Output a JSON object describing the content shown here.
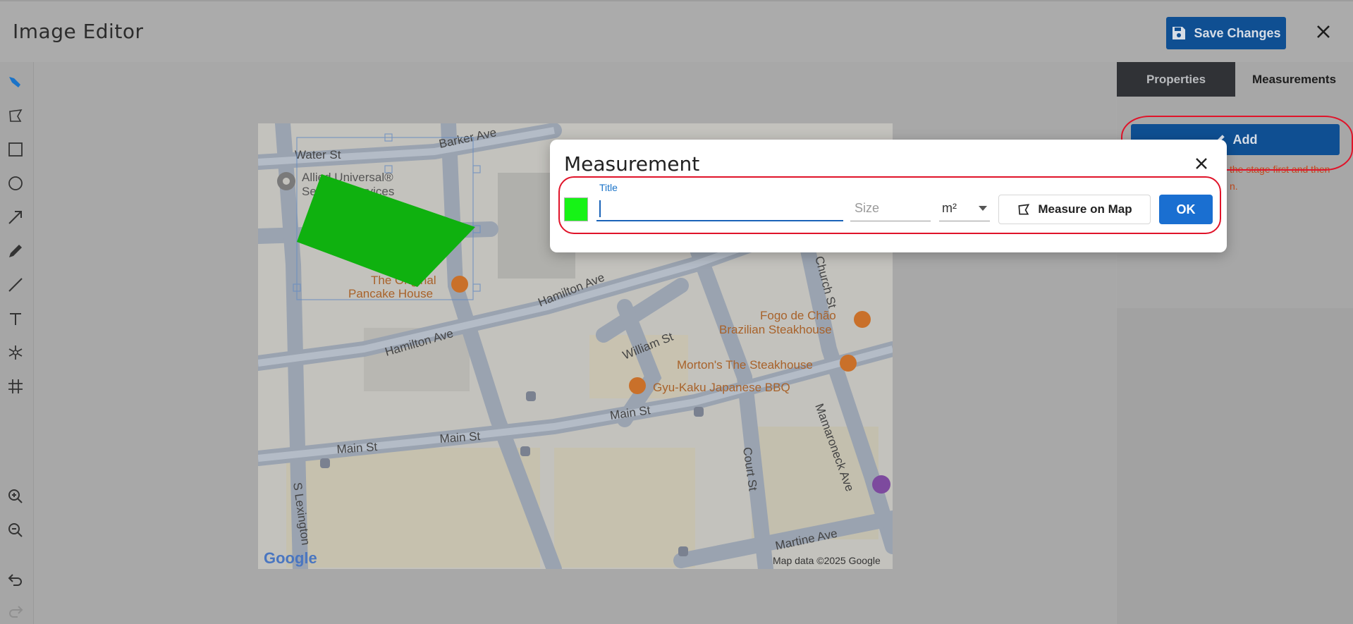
{
  "header": {
    "title": "Image Editor",
    "save_label": "Save Changes"
  },
  "toolbar": {
    "tools": [
      "select-icon",
      "polygon-icon",
      "rectangle-icon",
      "circle-icon",
      "arrow-icon",
      "pencil-icon",
      "line-icon",
      "text-icon",
      "snowflake-icon",
      "grid-icon",
      "zoom-in-icon",
      "zoom-out-icon",
      "undo-icon",
      "redo-icon"
    ]
  },
  "map": {
    "streets": [
      "Water St",
      "Barker Ave",
      "Hamilton Ave",
      "Hamilton Ave",
      "William St",
      "Main St",
      "Main St",
      "Main St",
      "Court St",
      "Mamaroneck Ave",
      "Martine Ave",
      "S Lexington",
      "Church St"
    ],
    "places": [
      "Allied Universal® Security Services",
      "The Original Pancake House",
      "Fogo de Chão Brazilian Steakhouse",
      "Morton's The Steakhouse",
      "Gyu-Kaku Japanese BBQ"
    ],
    "attribution": "Map data ©2025 Google",
    "google": "Google",
    "polygon_color": "#0fb10f"
  },
  "panel": {
    "tabs": [
      "Properties",
      "Measurements"
    ],
    "add_label": "Add",
    "hint_line1": "the stage first and then",
    "hint_line2": "n."
  },
  "modal": {
    "title": "Measurement",
    "title_label": "Title",
    "title_value": "",
    "size_placeholder": "Size",
    "unit": "m²",
    "measure_label": "Measure on Map",
    "ok_label": "OK",
    "color": "#16f316"
  }
}
